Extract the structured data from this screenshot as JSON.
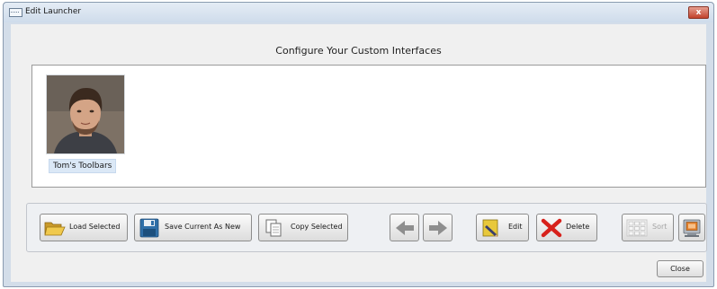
{
  "window": {
    "title": "Edit Launcher",
    "close_glyph": "x"
  },
  "main": {
    "heading": "Configure Your Custom Interfaces"
  },
  "launchers": [
    {
      "label": "Tom's Toolbars",
      "icon": "user-photo"
    }
  ],
  "toolbar": {
    "load_label": "Load Selected",
    "save_label": "Save Current As New",
    "copy_label": "Copy Selected",
    "edit_label": "Edit",
    "delete_label": "Delete",
    "sort_label": "Sort"
  },
  "footer": {
    "close_label": "Close"
  },
  "colors": {
    "window_border": "#8a9bb0",
    "close_red": "#c1412b",
    "selection": "#dbe8f6",
    "folder": "#e2b63b",
    "save_blue": "#2f6fa8",
    "delete_red": "#d7211b"
  }
}
